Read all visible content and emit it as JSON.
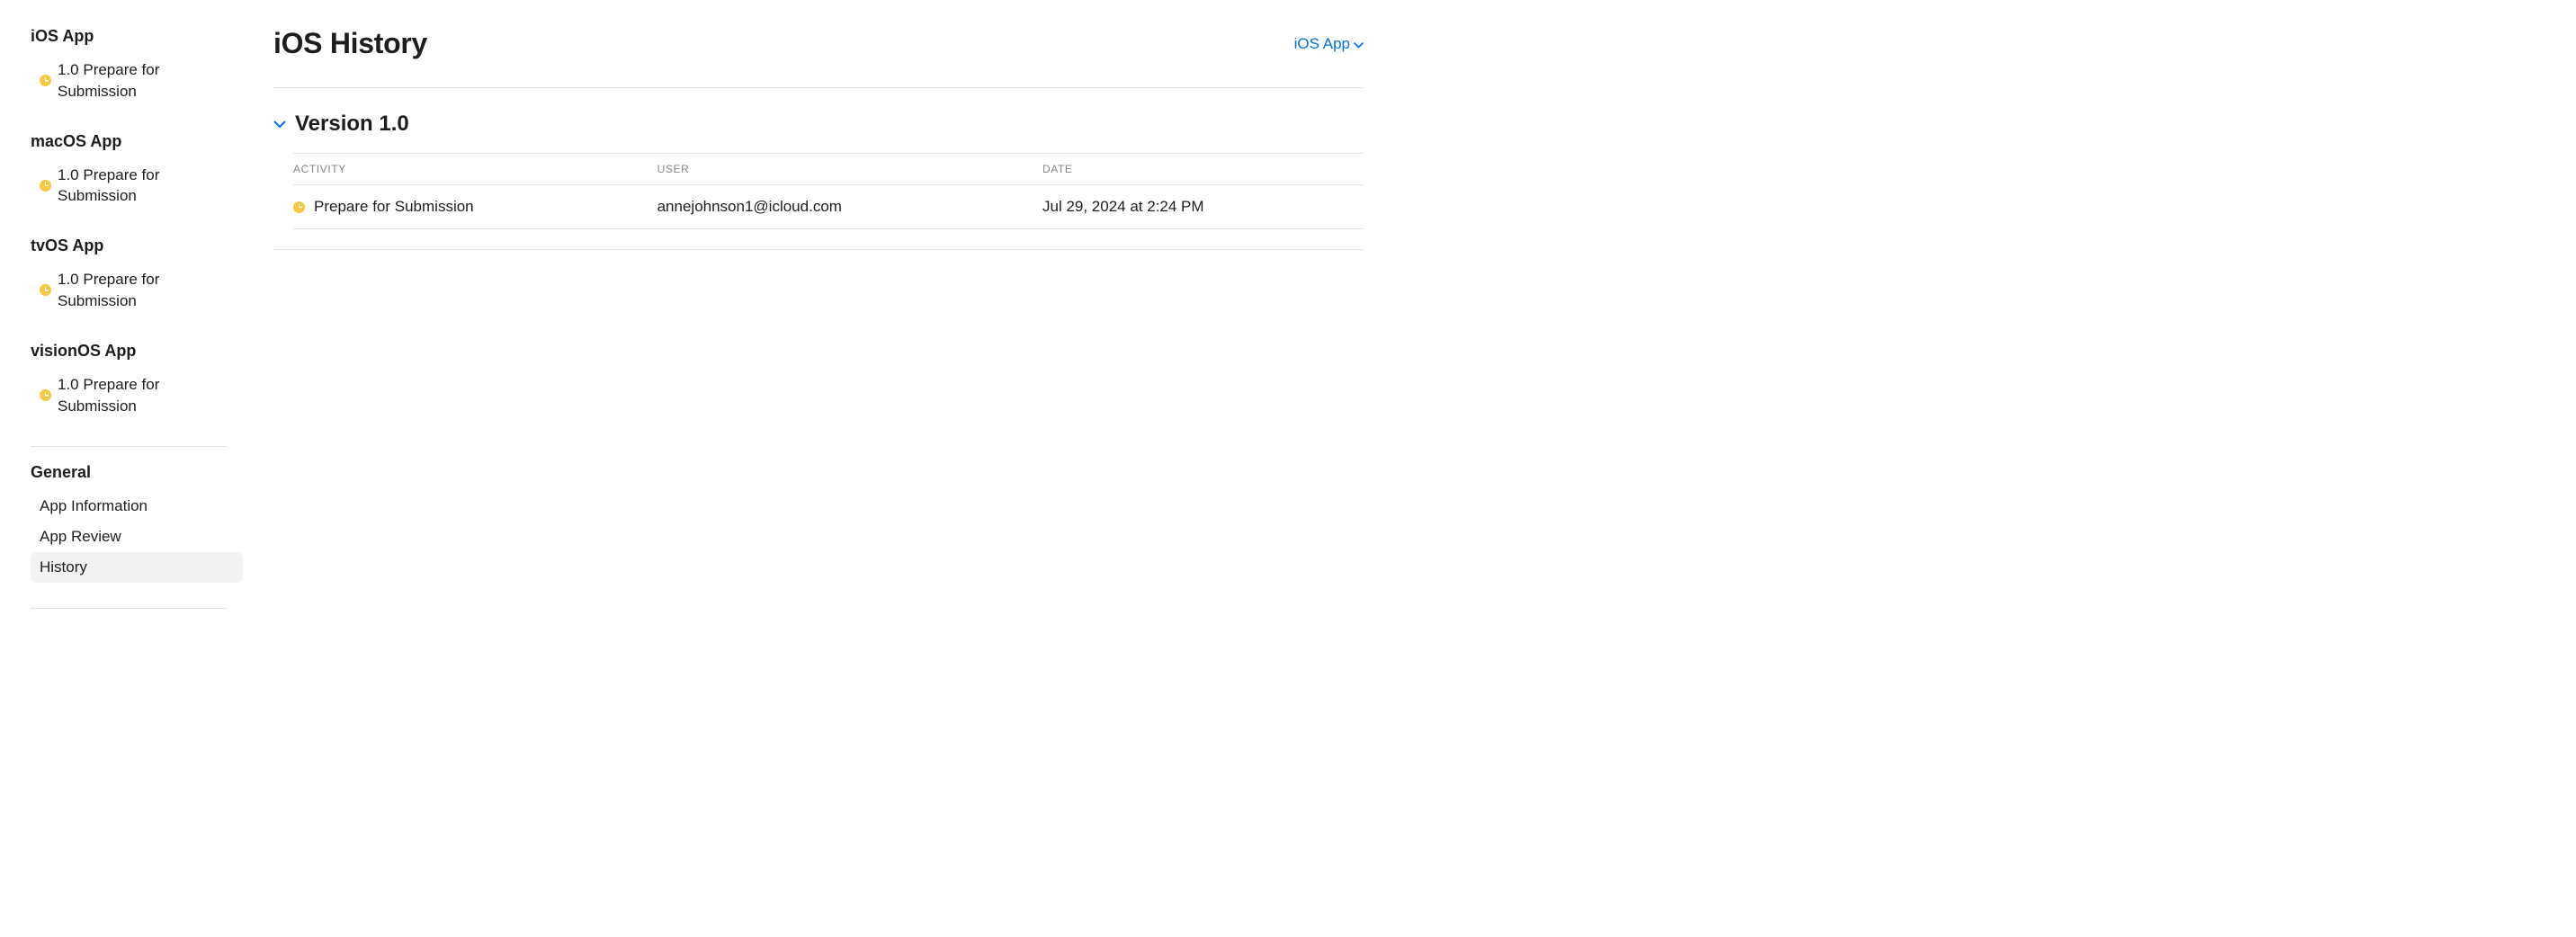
{
  "sidebar": {
    "platforms": [
      {
        "heading": "iOS App",
        "status_label": "1.0 Prepare for Submission"
      },
      {
        "heading": "macOS App",
        "status_label": "1.0 Prepare for Submission"
      },
      {
        "heading": "tvOS App",
        "status_label": "1.0 Prepare for Submission"
      },
      {
        "heading": "visionOS App",
        "status_label": "1.0 Prepare for Submission"
      }
    ],
    "general_heading": "General",
    "general_items": [
      {
        "label": "App Information",
        "selected": false
      },
      {
        "label": "App Review",
        "selected": false
      },
      {
        "label": "History",
        "selected": true
      }
    ]
  },
  "main": {
    "title": "iOS History",
    "platform_switch_label": "iOS App",
    "version_heading": "Version 1.0",
    "columns": {
      "activity": "ACTIVITY",
      "user": "USER",
      "date": "DATE"
    },
    "rows": [
      {
        "activity": "Prepare for Submission",
        "user": "annejohnson1@icloud.com",
        "date": "Jul 29, 2024 at 2:24 PM"
      }
    ]
  }
}
